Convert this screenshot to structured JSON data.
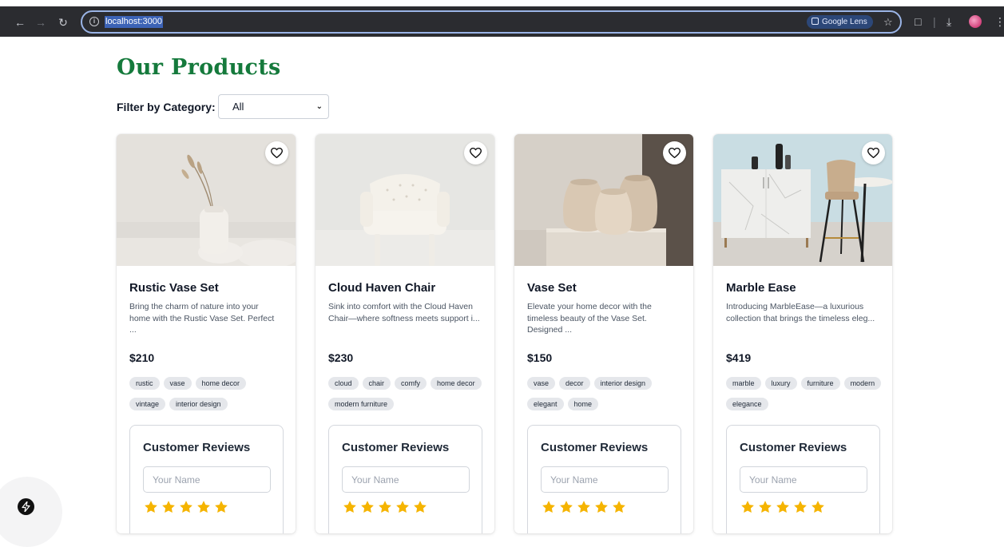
{
  "browser": {
    "url": "localhost:3000",
    "lens_label": "Google Lens"
  },
  "page": {
    "title": "Our Products",
    "filter_label": "Filter by Category:",
    "filter_value": "All"
  },
  "reviews_ui": {
    "title": "Customer Reviews",
    "name_placeholder": "Your Name"
  },
  "products": [
    {
      "name": "Rustic Vase Set",
      "description": "Bring the charm of nature into your home with the Rustic Vase Set. Perfect ...",
      "price": "$210",
      "tags": [
        "rustic",
        "vase",
        "home decor",
        "vintage",
        "interior design"
      ],
      "rating": 5
    },
    {
      "name": "Cloud Haven Chair",
      "description": "Sink into comfort with the Cloud Haven Chair—where softness meets support i...",
      "price": "$230",
      "tags": [
        "cloud",
        "chair",
        "comfy",
        "home decor",
        "modern furniture"
      ],
      "rating": 5
    },
    {
      "name": "Vase Set",
      "description": "Elevate your home decor with the timeless beauty of the Vase Set. Designed ...",
      "price": "$150",
      "tags": [
        "vase",
        "decor",
        "interior design",
        "elegant",
        "home"
      ],
      "rating": 5
    },
    {
      "name": "Marble Ease",
      "description": "Introducing MarbleEase—a luxurious collection that brings the timeless eleg...",
      "price": "$419",
      "tags": [
        "marble",
        "luxury",
        "furniture",
        "modern",
        "elegance"
      ],
      "rating": 5
    }
  ],
  "colors": {
    "title_green": "#157a3c",
    "star_gold": "#f5b400",
    "tag_bg": "#e5e7eb"
  },
  "icons": {
    "favorite": "heart-outline-icon",
    "rating": "star-icon",
    "dev_tools": "lightning-icon"
  }
}
